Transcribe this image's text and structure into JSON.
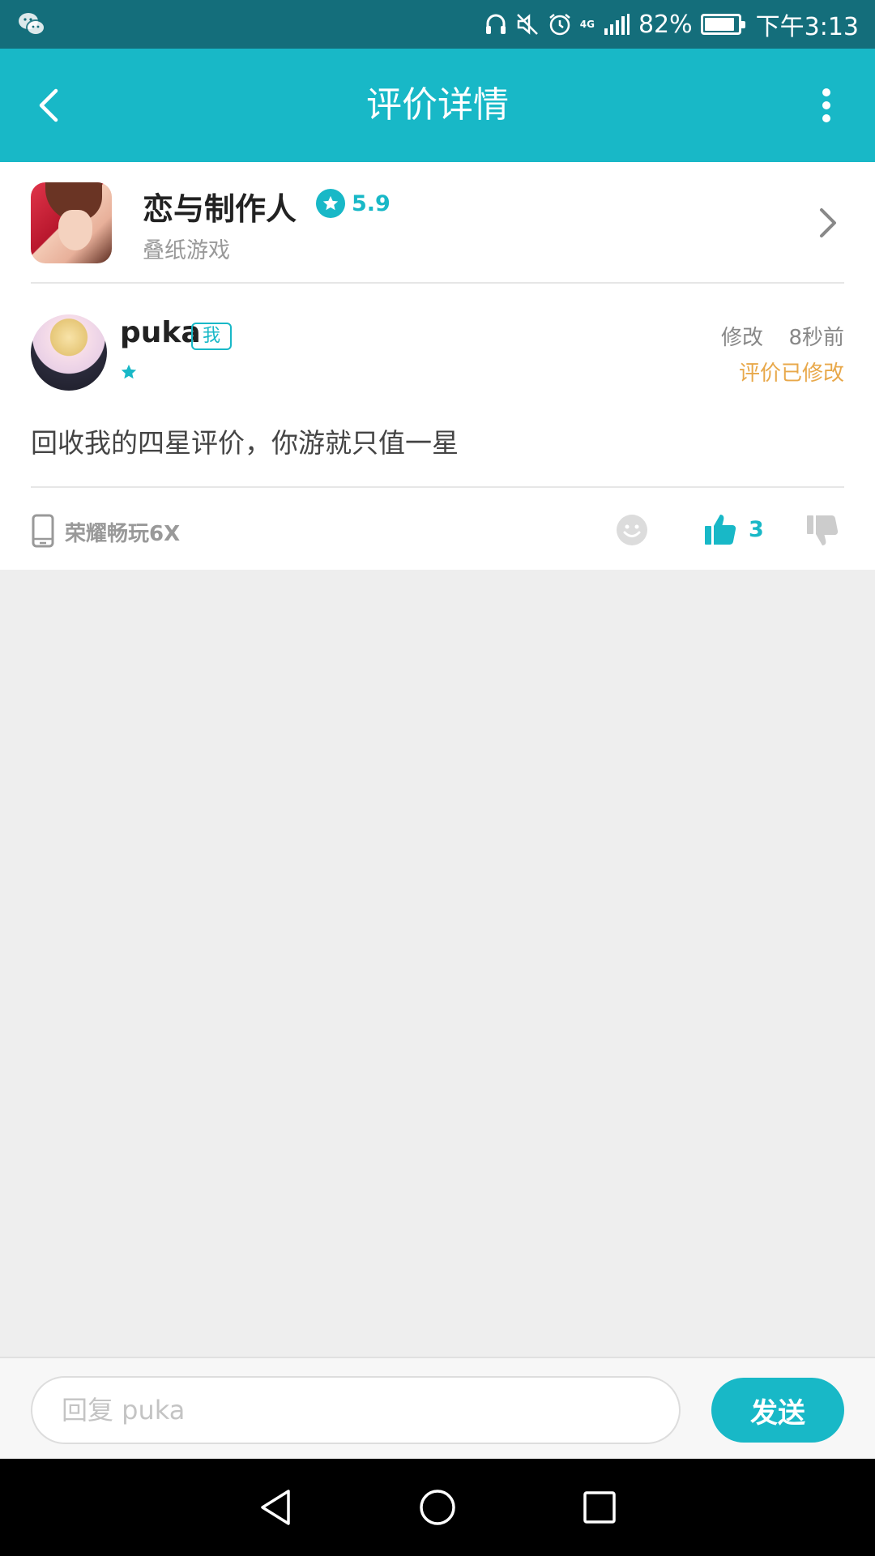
{
  "status_bar": {
    "battery_percent": "82%",
    "battery_level": 0.82,
    "time": "下午3:13",
    "network": "4G"
  },
  "app_bar": {
    "title": "评价详情"
  },
  "game": {
    "name": "恋与制作人",
    "rating": "5.9",
    "publisher": "叠纸游戏"
  },
  "review": {
    "username": "puka",
    "me_badge": "我",
    "star_count": 1,
    "edit_label": "修改",
    "time_ago": "8秒前",
    "edited_label": "评价已修改",
    "text": "回收我的四星评价，你游就只值一星",
    "device": "荣耀畅玩6X",
    "like_count": "3"
  },
  "reply": {
    "placeholder": "回复 puka",
    "send_label": "发送"
  },
  "colors": {
    "accent": "#18b8c7",
    "status_bar": "#146e7b",
    "edited": "#e8a84a"
  },
  "icons": [
    "wechat-icon",
    "headphones-icon",
    "mute-icon",
    "alarm-icon",
    "signal-icon",
    "battery-icon",
    "back-arrow-icon",
    "more-vert-icon",
    "star-icon",
    "chevron-right-icon",
    "phone-icon",
    "emoji-icon",
    "thumbs-up-icon",
    "thumbs-down-icon",
    "nav-back-icon",
    "nav-home-icon",
    "nav-recents-icon"
  ]
}
